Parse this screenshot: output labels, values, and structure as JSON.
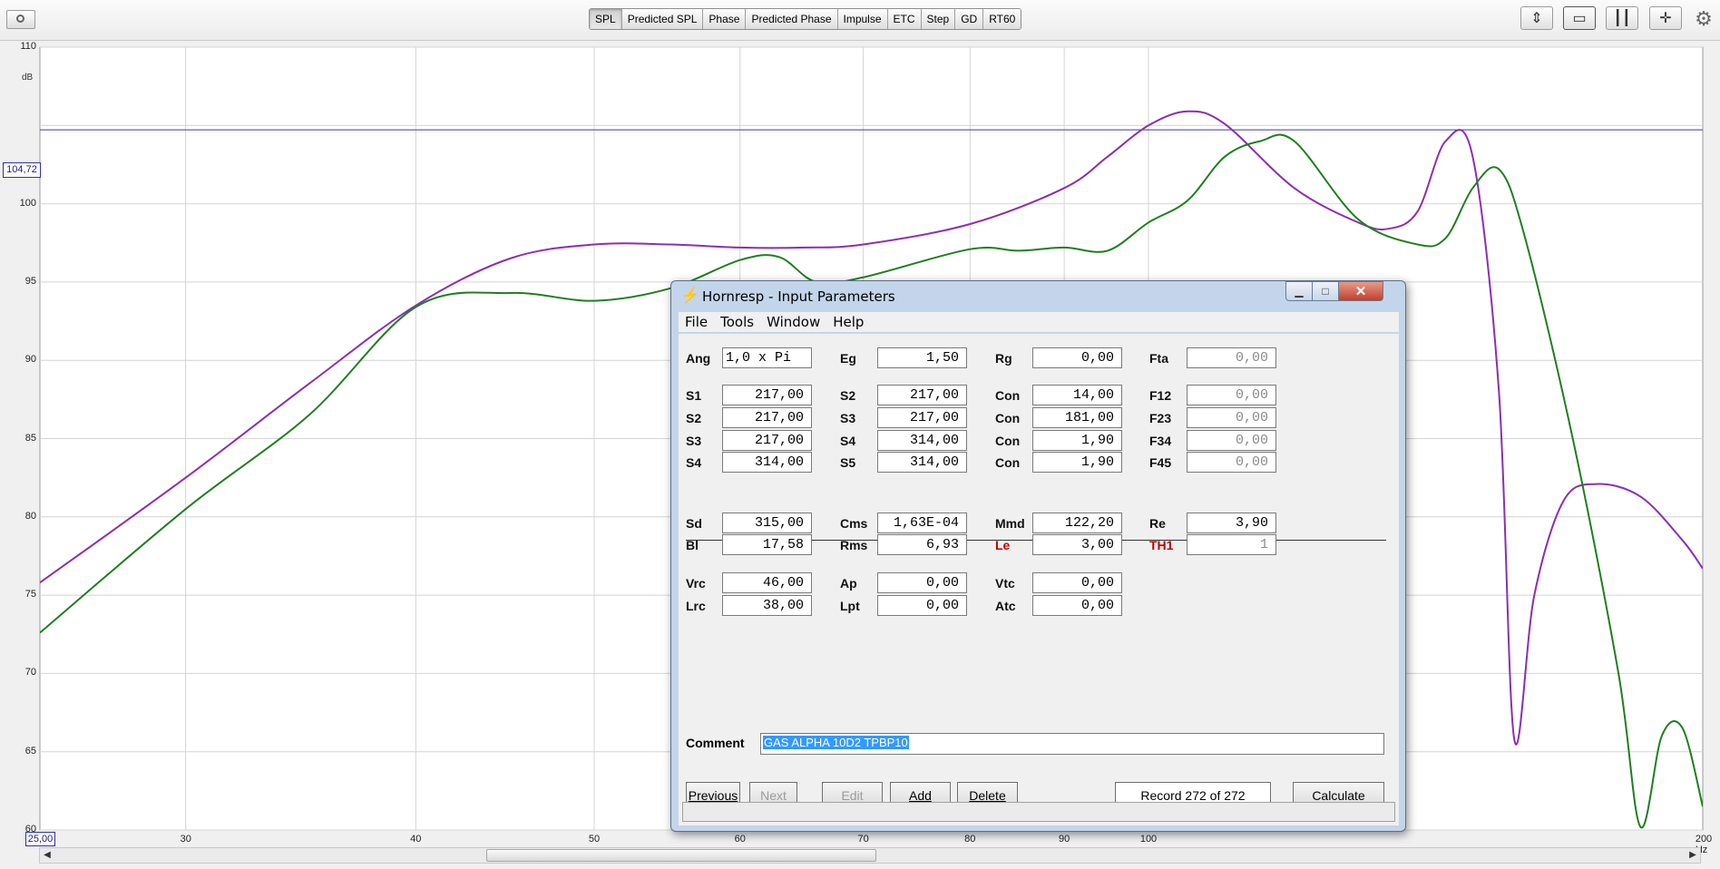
{
  "toolbar": {
    "tabs": [
      "SPL",
      "Predicted SPL",
      "Phase",
      "Predicted Phase",
      "Impulse",
      "ETC",
      "Step",
      "GD",
      "RT60"
    ],
    "active_tab": "SPL"
  },
  "graph": {
    "y_unit": "dB",
    "x_unit": "200 Hz",
    "cursor_value": "104,72",
    "x_start_value": "25,00",
    "y_ticks": [
      "110",
      "100",
      "95",
      "90",
      "85",
      "80",
      "75",
      "70",
      "65",
      "60"
    ],
    "x_ticks": [
      "30",
      "40",
      "50",
      "60",
      "70",
      "80",
      "90",
      "100"
    ],
    "colors": {
      "trace_purple": "#8b2fb0",
      "trace_green": "#1f7f1f",
      "cursor_line": "#3a3aa0",
      "grid": "#d4d4d4"
    }
  },
  "chart_data": {
    "type": "line",
    "title": "",
    "xlabel": "",
    "ylabel": "dB",
    "x_scale": "log",
    "xlim": [
      25,
      200
    ],
    "ylim": [
      60,
      110
    ],
    "grid": true,
    "cursor_y": 104.72,
    "series": [
      {
        "color": "#8b2fb0",
        "points": [
          [
            25,
            75.8
          ],
          [
            30,
            82.5
          ],
          [
            35,
            88.5
          ],
          [
            40,
            93.5
          ],
          [
            45,
            96.5
          ],
          [
            50,
            97.4
          ],
          [
            55,
            97.4
          ],
          [
            60,
            97.2
          ],
          [
            65,
            97.2
          ],
          [
            70,
            97.4
          ],
          [
            80,
            98.7
          ],
          [
            90,
            101
          ],
          [
            95,
            103
          ],
          [
            100,
            105
          ],
          [
            105,
            105.9
          ],
          [
            110,
            105.1
          ],
          [
            120,
            101
          ],
          [
            130,
            98.8
          ],
          [
            135,
            98.4
          ],
          [
            140,
            99.5
          ],
          [
            145,
            104
          ],
          [
            150,
            103
          ],
          [
            155,
            88
          ],
          [
            158,
            65.8
          ],
          [
            162,
            75
          ],
          [
            168,
            81
          ],
          [
            175,
            82.1
          ],
          [
            185,
            81.3
          ],
          [
            195,
            78.5
          ],
          [
            200,
            76.7
          ]
        ]
      },
      {
        "color": "#1f7f1f",
        "points": [
          [
            25,
            72.6
          ],
          [
            30,
            80.5
          ],
          [
            35,
            86.5
          ],
          [
            40,
            93.4
          ],
          [
            45,
            94.3
          ],
          [
            50,
            93.8
          ],
          [
            55,
            94.6
          ],
          [
            60,
            96.4
          ],
          [
            63,
            96.6
          ],
          [
            66,
            95
          ],
          [
            70,
            95.3
          ],
          [
            80,
            97.1
          ],
          [
            85,
            97
          ],
          [
            90,
            97.2
          ],
          [
            95,
            97
          ],
          [
            100,
            98.8
          ],
          [
            105,
            100.2
          ],
          [
            110,
            103
          ],
          [
            115,
            104
          ],
          [
            120,
            104
          ],
          [
            130,
            99
          ],
          [
            140,
            97.4
          ],
          [
            145,
            97.8
          ],
          [
            150,
            101
          ],
          [
            155,
            102.2
          ],
          [
            160,
            98
          ],
          [
            170,
            85
          ],
          [
            180,
            70
          ],
          [
            185,
            60.2
          ],
          [
            190,
            66
          ],
          [
            195,
            66.5
          ],
          [
            200,
            61.5
          ]
        ]
      }
    ]
  },
  "dialog": {
    "title": "Hornresp - Input Parameters",
    "menus": [
      "File",
      "Tools",
      "Window",
      "Help"
    ],
    "rows1": [
      [
        {
          "l": "Ang",
          "v": "1,0 x Pi"
        },
        {
          "l": "Eg",
          "v": "1,50"
        },
        {
          "l": "Rg",
          "v": "0,00"
        },
        {
          "l": "Fta",
          "v": "0,00"
        }
      ]
    ],
    "rows2": [
      [
        {
          "l": "S1",
          "v": "217,00"
        },
        {
          "l": "S2",
          "v": "217,00"
        },
        {
          "l": "Con",
          "v": "14,00"
        },
        {
          "l": "F12",
          "v": "0,00"
        }
      ],
      [
        {
          "l": "S2",
          "v": "217,00"
        },
        {
          "l": "S3",
          "v": "217,00"
        },
        {
          "l": "Con",
          "v": "181,00"
        },
        {
          "l": "F23",
          "v": "0,00"
        }
      ],
      [
        {
          "l": "S3",
          "v": "217,00"
        },
        {
          "l": "S4",
          "v": "314,00"
        },
        {
          "l": "Con",
          "v": "1,90"
        },
        {
          "l": "F34",
          "v": "0,00"
        }
      ],
      [
        {
          "l": "S4",
          "v": "314,00"
        },
        {
          "l": "S5",
          "v": "314,00"
        },
        {
          "l": "Con",
          "v": "1,90"
        },
        {
          "l": "F45",
          "v": "0,00"
        }
      ]
    ],
    "rows3": [
      [
        {
          "l": "Sd",
          "v": "315,00"
        },
        {
          "l": "Cms",
          "v": "1,63E-04"
        },
        {
          "l": "Mmd",
          "v": "122,20"
        },
        {
          "l": "Re",
          "v": "3,90"
        }
      ],
      [
        {
          "l": "Bl",
          "v": "17,58"
        },
        {
          "l": "Rms",
          "v": "6,93"
        },
        {
          "l": "Le",
          "v": "3,00"
        },
        {
          "l": "TH1",
          "v": "1"
        }
      ]
    ],
    "rows4": [
      [
        {
          "l": "Vrc",
          "v": "46,00"
        },
        {
          "l": "Ap",
          "v": "0,00"
        },
        {
          "l": "Vtc",
          "v": "0,00"
        }
      ],
      [
        {
          "l": "Lrc",
          "v": "38,00"
        },
        {
          "l": "Lpt",
          "v": "0,00"
        },
        {
          "l": "Atc",
          "v": "0,00"
        }
      ]
    ],
    "comment_label": "Comment",
    "comment_value": "GAS ALPHA 10D2 TPBP10",
    "buttons": {
      "previous": "Previous",
      "next": "Next",
      "edit": "Edit",
      "add": "Add",
      "delete": "Delete",
      "calculate": "Calculate"
    },
    "record": "Record 272 of 272"
  }
}
